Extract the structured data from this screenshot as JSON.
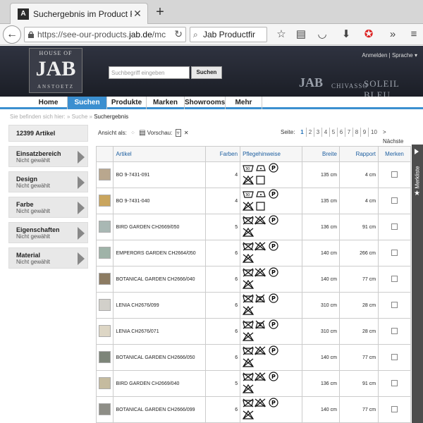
{
  "browser": {
    "tab_title": "Suchergebnis im Product F",
    "favicon_letter": "A",
    "url_prefix": "https://see-our-products.",
    "url_domain": "jab.de",
    "url_suffix": "/mc",
    "search_text": "Jab Productfir"
  },
  "header": {
    "logo_top": "HOUSE OF",
    "logo_main": "JAB",
    "logo_sub": "ANSTOETZ",
    "search_placeholder": "Suchbegriff eingeben",
    "search_button": "Suchen",
    "links": "Anmelden | Sprache ▾",
    "brand_jab": "JAB",
    "brand_chivasso": "CHIVASSO",
    "brand_soleil": "SOLEIL BLEU"
  },
  "nav": [
    {
      "label": "Home",
      "active": false
    },
    {
      "label": "Suchen",
      "active": true
    },
    {
      "label": "Produkte",
      "active": false
    },
    {
      "label": "Marken",
      "active": false
    },
    {
      "label": "Showrooms",
      "active": false
    },
    {
      "label": "Mehr",
      "active": false
    }
  ],
  "breadcrumb": {
    "prefix": "Sie befinden sich hier: » Suche » ",
    "current": "Suchergebnis"
  },
  "sidebar": {
    "count": "12399 Artikel",
    "facets": [
      {
        "title": "Einsatzbereich",
        "sub": "Nicht gewählt"
      },
      {
        "title": "Design",
        "sub": "Nicht gewählt"
      },
      {
        "title": "Farbe",
        "sub": "Nicht gewählt"
      },
      {
        "title": "Eigenschaften",
        "sub": "Nicht gewählt"
      },
      {
        "title": "Material",
        "sub": "Nicht gewählt"
      }
    ]
  },
  "toolbar": {
    "view_label": "Ansicht als:",
    "preview_label": "Vorschau:",
    "page_label": "Seite:",
    "pages": [
      "1",
      "2",
      "3",
      "4",
      "5",
      "6",
      "7",
      "8",
      "9",
      "10"
    ],
    "current_page": "1",
    "next_label": "> Nächste"
  },
  "table": {
    "headers": [
      "Artikel",
      "Farben",
      "Pflegehinweise",
      "Breite",
      "Rapport",
      "Merken"
    ],
    "rows": [
      {
        "name": "BO 9-7431-091",
        "colors": "4",
        "width": "135 cm",
        "rapport": "4 cm",
        "thumb": "#b9a78e"
      },
      {
        "name": "BO 9-7431-040",
        "colors": "4",
        "width": "135 cm",
        "rapport": "4 cm",
        "thumb": "#c9a55e"
      },
      {
        "name": "BIRD GARDEN CH2669/050",
        "colors": "5",
        "width": "136 cm",
        "rapport": "91 cm",
        "thumb": "#a9b8b4"
      },
      {
        "name": "EMPERORS GARDEN CH2664/050",
        "colors": "6",
        "width": "140 cm",
        "rapport": "266 cm",
        "thumb": "#9fb3a8"
      },
      {
        "name": "BOTANICAL GARDEN CH2666/040",
        "colors": "6",
        "width": "140 cm",
        "rapport": "77 cm",
        "thumb": "#8c7b62"
      },
      {
        "name": "LENIA CH2676/099",
        "colors": "6",
        "width": "310 cm",
        "rapport": "28 cm",
        "thumb": "#d2d0ca"
      },
      {
        "name": "LENIA CH2676/071",
        "colors": "6",
        "width": "310 cm",
        "rapport": "28 cm",
        "thumb": "#ddd6c5"
      },
      {
        "name": "BOTANICAL GARDEN CH2666/050",
        "colors": "6",
        "width": "140 cm",
        "rapport": "77 cm",
        "thumb": "#7d8579"
      },
      {
        "name": "BIRD GARDEN CH2669/040",
        "colors": "5",
        "width": "136 cm",
        "rapport": "91 cm",
        "thumb": "#c5bb9f"
      },
      {
        "name": "BOTANICAL GARDEN CH2666/099",
        "colors": "6",
        "width": "140 cm",
        "rapport": "77 cm",
        "thumb": "#8d8d86"
      }
    ]
  },
  "merkliste": {
    "label": "Merkliste"
  },
  "colors": {
    "accent": "#3b8fd0",
    "header_bg": "#252832",
    "link": "#1e5fa0"
  }
}
